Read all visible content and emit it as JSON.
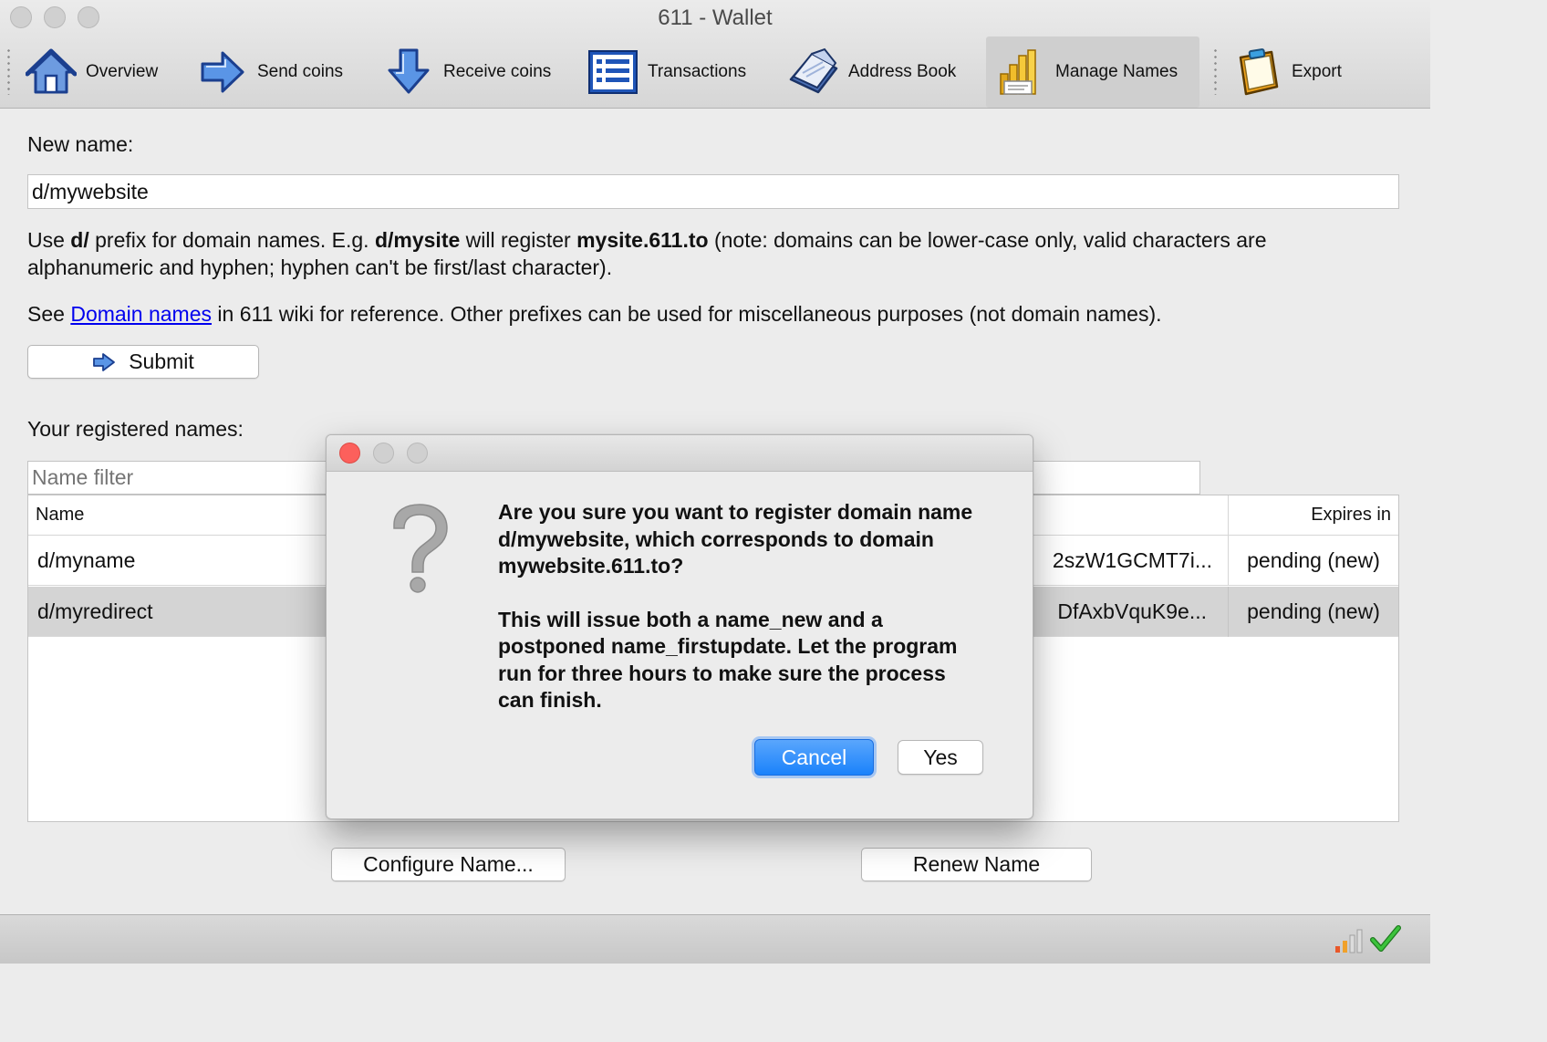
{
  "window": {
    "title": "611 - Wallet"
  },
  "toolbar": {
    "items": [
      {
        "label": "Overview",
        "icon": "home-icon"
      },
      {
        "label": "Send coins",
        "icon": "arrow-right-icon"
      },
      {
        "label": "Receive coins",
        "icon": "arrow-down-icon"
      },
      {
        "label": "Transactions",
        "icon": "list-icon"
      },
      {
        "label": "Address Book",
        "icon": "address-book-icon"
      },
      {
        "label": "Manage Names",
        "icon": "names-icon",
        "active": true
      },
      {
        "label": "Export",
        "icon": "clipboard-icon"
      }
    ]
  },
  "new_name": {
    "label": "New name:",
    "value": "d/mywebsite"
  },
  "help": {
    "line1_a": "Use ",
    "line1_b": "d/",
    "line1_c": " prefix for domain names. E.g. ",
    "line1_d": "d/mysite",
    "line1_e": " will register ",
    "line1_f": "mysite.611.to",
    "line1_g": " (note: domains can be lower-case only, valid characters are alphanumeric and hyphen; hyphen can't be first/last character).",
    "line2_a": "See ",
    "line2_link": "Domain names",
    "line2_b": " in 611 wiki for reference. Other prefixes can be used for miscellaneous purposes (not domain names)."
  },
  "submit_label": "Submit",
  "registered": {
    "label": "Your registered names:",
    "filter_placeholder": "Name filter",
    "columns": {
      "name": "Name",
      "expires": "Expires in"
    },
    "rows": [
      {
        "name": "d/myname",
        "address": "2szW1GCMT7i...",
        "expires": "pending (new)"
      },
      {
        "name": "d/myredirect",
        "address": "DfAxbVquK9e...",
        "expires": "pending (new)"
      }
    ]
  },
  "buttons": {
    "configure": "Configure Name...",
    "renew": "Renew Name"
  },
  "dialog": {
    "message_1": "Are you sure you want to register domain name d/mywebsite, which corresponds to domain mywebsite.611.to?",
    "message_2": "This will issue both a name_new and a postponed name_firstupdate. Let the program run for three hours to make sure the process can finish.",
    "cancel": "Cancel",
    "yes": "Yes",
    "icon": "question-mark-icon"
  },
  "status": {
    "icons": [
      "signal-strength-icon",
      "synced-checkmark-icon"
    ]
  },
  "colors": {
    "accent": "#1a82fb",
    "link": "#0000ee",
    "close": "#fc605c",
    "check": "#2aa82a"
  }
}
